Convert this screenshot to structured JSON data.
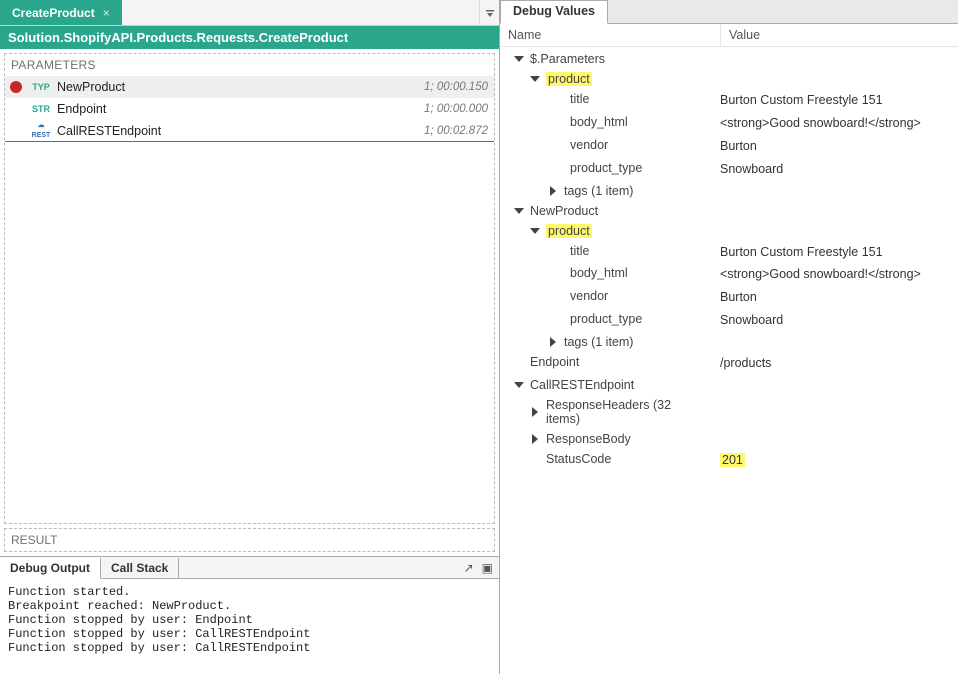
{
  "tab": {
    "title": "CreateProduct"
  },
  "breadcrumb": "Solution.ShopifyAPI.Products.Requests.CreateProduct",
  "panels": {
    "parameters_label": "PARAMETERS",
    "result_label": "RESULT"
  },
  "params": [
    {
      "bp": true,
      "type": "TYP",
      "name": "NewProduct",
      "time": "1; 00:00.150",
      "active": true
    },
    {
      "bp": false,
      "type": "STR",
      "name": "Endpoint",
      "time": "1; 00:00.000"
    },
    {
      "bp": false,
      "type": "REST",
      "name": "CallRESTEndpoint",
      "time": "1; 00:02.872",
      "redline": true
    }
  ],
  "bottom": {
    "tabs": {
      "output": "Debug Output",
      "callstack": "Call Stack"
    },
    "output_lines": [
      "Function started.",
      "Breakpoint reached: NewProduct.",
      "Function stopped by user: Endpoint",
      "Function stopped by user: CallRESTEndpoint",
      "Function stopped by user: CallRESTEndpoint"
    ]
  },
  "debug_values": {
    "title": "Debug Values",
    "columns": {
      "name": "Name",
      "value": "Value"
    },
    "product": {
      "label": "product",
      "title_key": "title",
      "title_value": "Burton Custom Freestyle 151",
      "body_key": "body_html",
      "body_value": "<strong>Good snowboard!</strong>",
      "vendor_key": "vendor",
      "vendor_value": "Burton",
      "ptype_key": "product_type",
      "ptype_value": "Snowboard",
      "tags_label": "tags (1 item)"
    },
    "nodes": {
      "parameters": "$.Parameters",
      "newproduct": "NewProduct",
      "endpoint": "Endpoint",
      "endpoint_value": "/products",
      "callrest": "CallRESTEndpoint",
      "respheaders": "ResponseHeaders (32 items)",
      "respbody": "ResponseBody",
      "statuscode": "StatusCode",
      "statuscode_value": "201"
    }
  }
}
